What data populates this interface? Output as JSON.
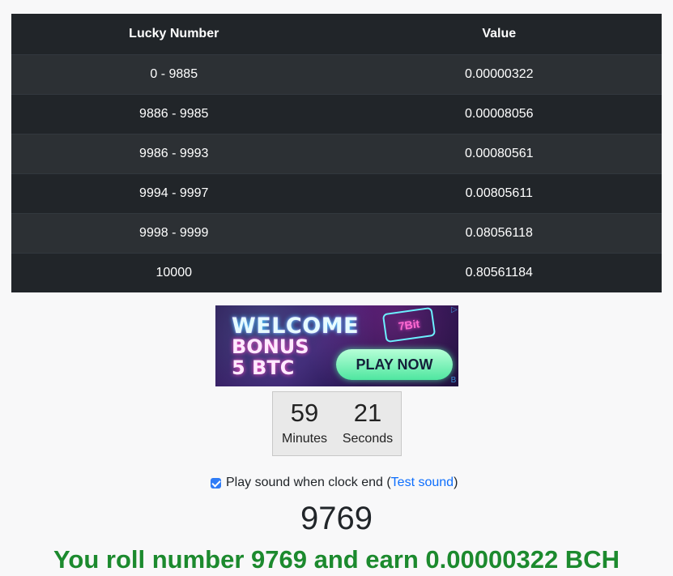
{
  "table": {
    "headers": [
      "Lucky Number",
      "Value"
    ],
    "rows": [
      {
        "range": "0 - 9885",
        "value": "0.00000322"
      },
      {
        "range": "9886 - 9985",
        "value": "0.00008056"
      },
      {
        "range": "9986 - 9993",
        "value": "0.00080561"
      },
      {
        "range": "9994 - 9997",
        "value": "0.00805611"
      },
      {
        "range": "9998 - 9999",
        "value": "0.08056118"
      },
      {
        "range": "10000",
        "value": "0.80561184"
      }
    ]
  },
  "ad": {
    "line1": "WELCOME",
    "line2": "BONUS",
    "line3": "5 BTC",
    "logo": "7Bit",
    "cta": "PLAY NOW",
    "choices_icon": "▷",
    "corner_mark": "B"
  },
  "countdown": {
    "minutes": "59",
    "minutes_label": "Minutes",
    "seconds": "21",
    "seconds_label": "Seconds"
  },
  "sound": {
    "checked": true,
    "label": "Play sound when clock end (",
    "test_link": "Test sound",
    "suffix": ")"
  },
  "roll": {
    "number": "9769",
    "message": "You roll number 9769 and earn 0.00000322 BCH"
  },
  "colors": {
    "table_bg": "#212529",
    "result_green": "#1c8a2e",
    "link_blue": "#0d6efd"
  }
}
